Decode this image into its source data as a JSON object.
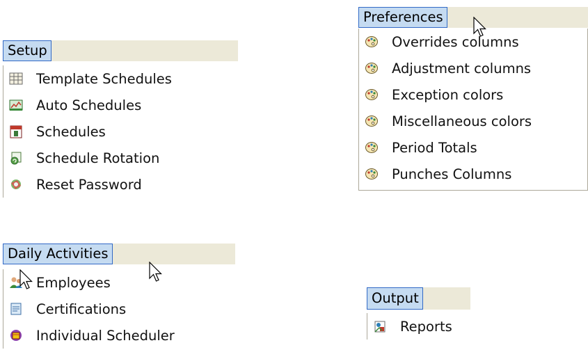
{
  "setup": {
    "title": "Setup",
    "items": [
      {
        "label": "Template Schedules",
        "icon": "template-schedules-icon"
      },
      {
        "label": "Auto Schedules",
        "icon": "auto-schedules-icon"
      },
      {
        "label": "Schedules",
        "icon": "schedules-calendar-icon"
      },
      {
        "label": "Schedule Rotation",
        "icon": "schedule-rotation-icon"
      },
      {
        "label": "Reset Password",
        "icon": "reset-password-icon"
      }
    ]
  },
  "preferences": {
    "title": "Preferences",
    "items": [
      {
        "label": "Overrides columns",
        "icon": "palette-icon"
      },
      {
        "label": "Adjustment columns",
        "icon": "palette-icon"
      },
      {
        "label": "Exception colors",
        "icon": "palette-icon"
      },
      {
        "label": "Miscellaneous colors",
        "icon": "palette-icon"
      },
      {
        "label": "Period Totals",
        "icon": "palette-icon"
      },
      {
        "label": "Punches Columns",
        "icon": "palette-icon"
      }
    ]
  },
  "daily_activities": {
    "title": "Daily Activities",
    "items": [
      {
        "label": "Employees",
        "icon": "employees-icon"
      },
      {
        "label": "Certifications",
        "icon": "certifications-icon"
      },
      {
        "label": "Individual Scheduler",
        "icon": "individual-scheduler-icon"
      }
    ]
  },
  "output": {
    "title": "Output",
    "items": [
      {
        "label": "Reports",
        "icon": "reports-icon"
      }
    ]
  },
  "colors": {
    "menu_bar": "#ece9d8",
    "title_highlight": "#c5dbf1",
    "title_border": "#3169c6",
    "item_border": "#aca899"
  }
}
